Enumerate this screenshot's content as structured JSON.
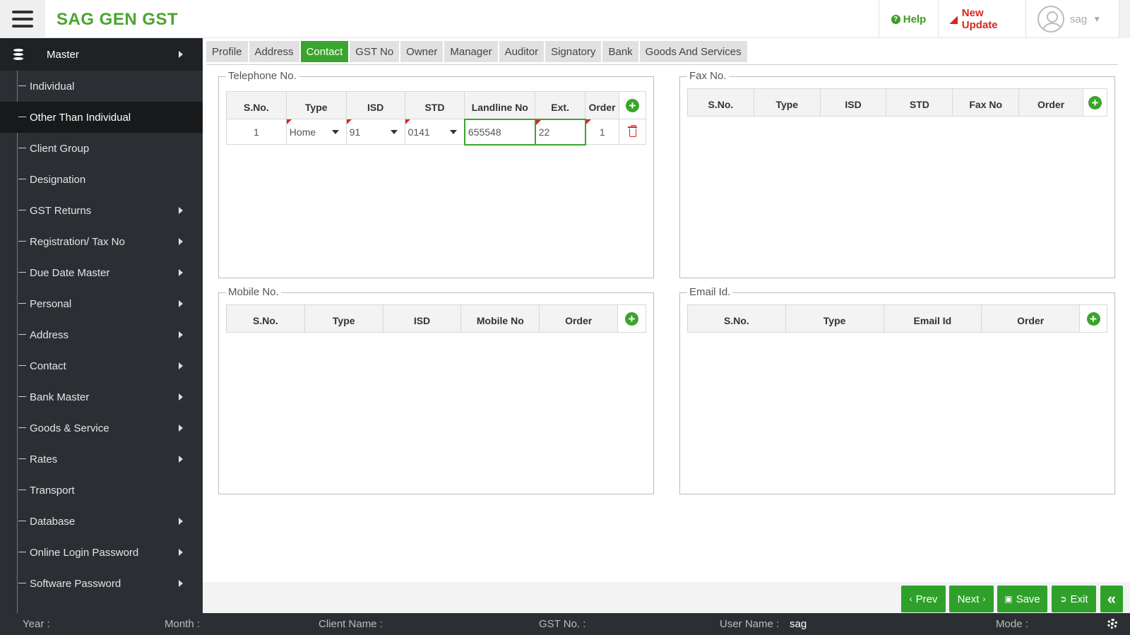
{
  "app": {
    "title": "SAG GEN GST"
  },
  "header": {
    "help_label": "Help",
    "new_update_label": "New Update",
    "user_name": "sag"
  },
  "sidebar": {
    "master_label": "Master",
    "items": [
      {
        "label": "Individual",
        "has_submenu": false,
        "active": false
      },
      {
        "label": "Other Than Individual",
        "has_submenu": false,
        "active": true
      },
      {
        "label": "Client Group",
        "has_submenu": false,
        "active": false
      },
      {
        "label": "Designation",
        "has_submenu": false,
        "active": false
      },
      {
        "label": "GST Returns",
        "has_submenu": true,
        "active": false
      },
      {
        "label": "Registration/ Tax No",
        "has_submenu": true,
        "active": false
      },
      {
        "label": "Due Date Master",
        "has_submenu": true,
        "active": false
      },
      {
        "label": "Personal",
        "has_submenu": true,
        "active": false
      },
      {
        "label": "Address",
        "has_submenu": true,
        "active": false
      },
      {
        "label": "Contact",
        "has_submenu": true,
        "active": false
      },
      {
        "label": "Bank Master",
        "has_submenu": true,
        "active": false
      },
      {
        "label": "Goods & Service",
        "has_submenu": true,
        "active": false
      },
      {
        "label": "Rates",
        "has_submenu": true,
        "active": false
      },
      {
        "label": "Transport",
        "has_submenu": false,
        "active": false
      },
      {
        "label": "Database",
        "has_submenu": true,
        "active": false
      },
      {
        "label": "Online Login Password",
        "has_submenu": true,
        "active": false
      },
      {
        "label": "Software Password",
        "has_submenu": true,
        "active": false
      }
    ]
  },
  "tabs": [
    {
      "label": "Profile",
      "active": false
    },
    {
      "label": "Address",
      "active": false
    },
    {
      "label": "Contact",
      "active": true
    },
    {
      "label": "GST No",
      "active": false
    },
    {
      "label": "Owner",
      "active": false
    },
    {
      "label": "Manager",
      "active": false
    },
    {
      "label": "Auditor",
      "active": false
    },
    {
      "label": "Signatory",
      "active": false
    },
    {
      "label": "Bank",
      "active": false
    },
    {
      "label": "Goods And Services",
      "active": false
    }
  ],
  "telephone": {
    "legend": "Telephone No.",
    "columns": [
      "S.No.",
      "Type",
      "ISD",
      "STD",
      "Landline No",
      "Ext.",
      "Order"
    ],
    "rows": [
      {
        "sno": "1",
        "type": "Home",
        "isd": "91",
        "std": "0141",
        "landline": "655548",
        "ext": "22",
        "order": "1"
      }
    ]
  },
  "fax": {
    "legend": "Fax No.",
    "columns": [
      "S.No.",
      "Type",
      "ISD",
      "STD",
      "Fax No",
      "Order"
    ]
  },
  "mobile": {
    "legend": "Mobile No.",
    "columns": [
      "S.No.",
      "Type",
      "ISD",
      "Mobile No",
      "Order"
    ]
  },
  "email": {
    "legend": "Email Id.",
    "columns": [
      "S.No.",
      "Type",
      "Email Id",
      "Order"
    ]
  },
  "actions": {
    "prev_label": "Prev",
    "next_label": "Next",
    "save_label": "Save",
    "exit_label": "Exit"
  },
  "status": {
    "year_label": "Year :",
    "month_label": "Month :",
    "client_label": "Client Name :",
    "gst_label": "GST No. :",
    "user_label": "User Name :",
    "user_value": "sag",
    "mode_label": "Mode :"
  },
  "colors": {
    "accent_green": "#3aa52c",
    "brand_green": "#4aa62d",
    "alert_red": "#d9261c",
    "sidebar_bg": "#2b2f33"
  }
}
